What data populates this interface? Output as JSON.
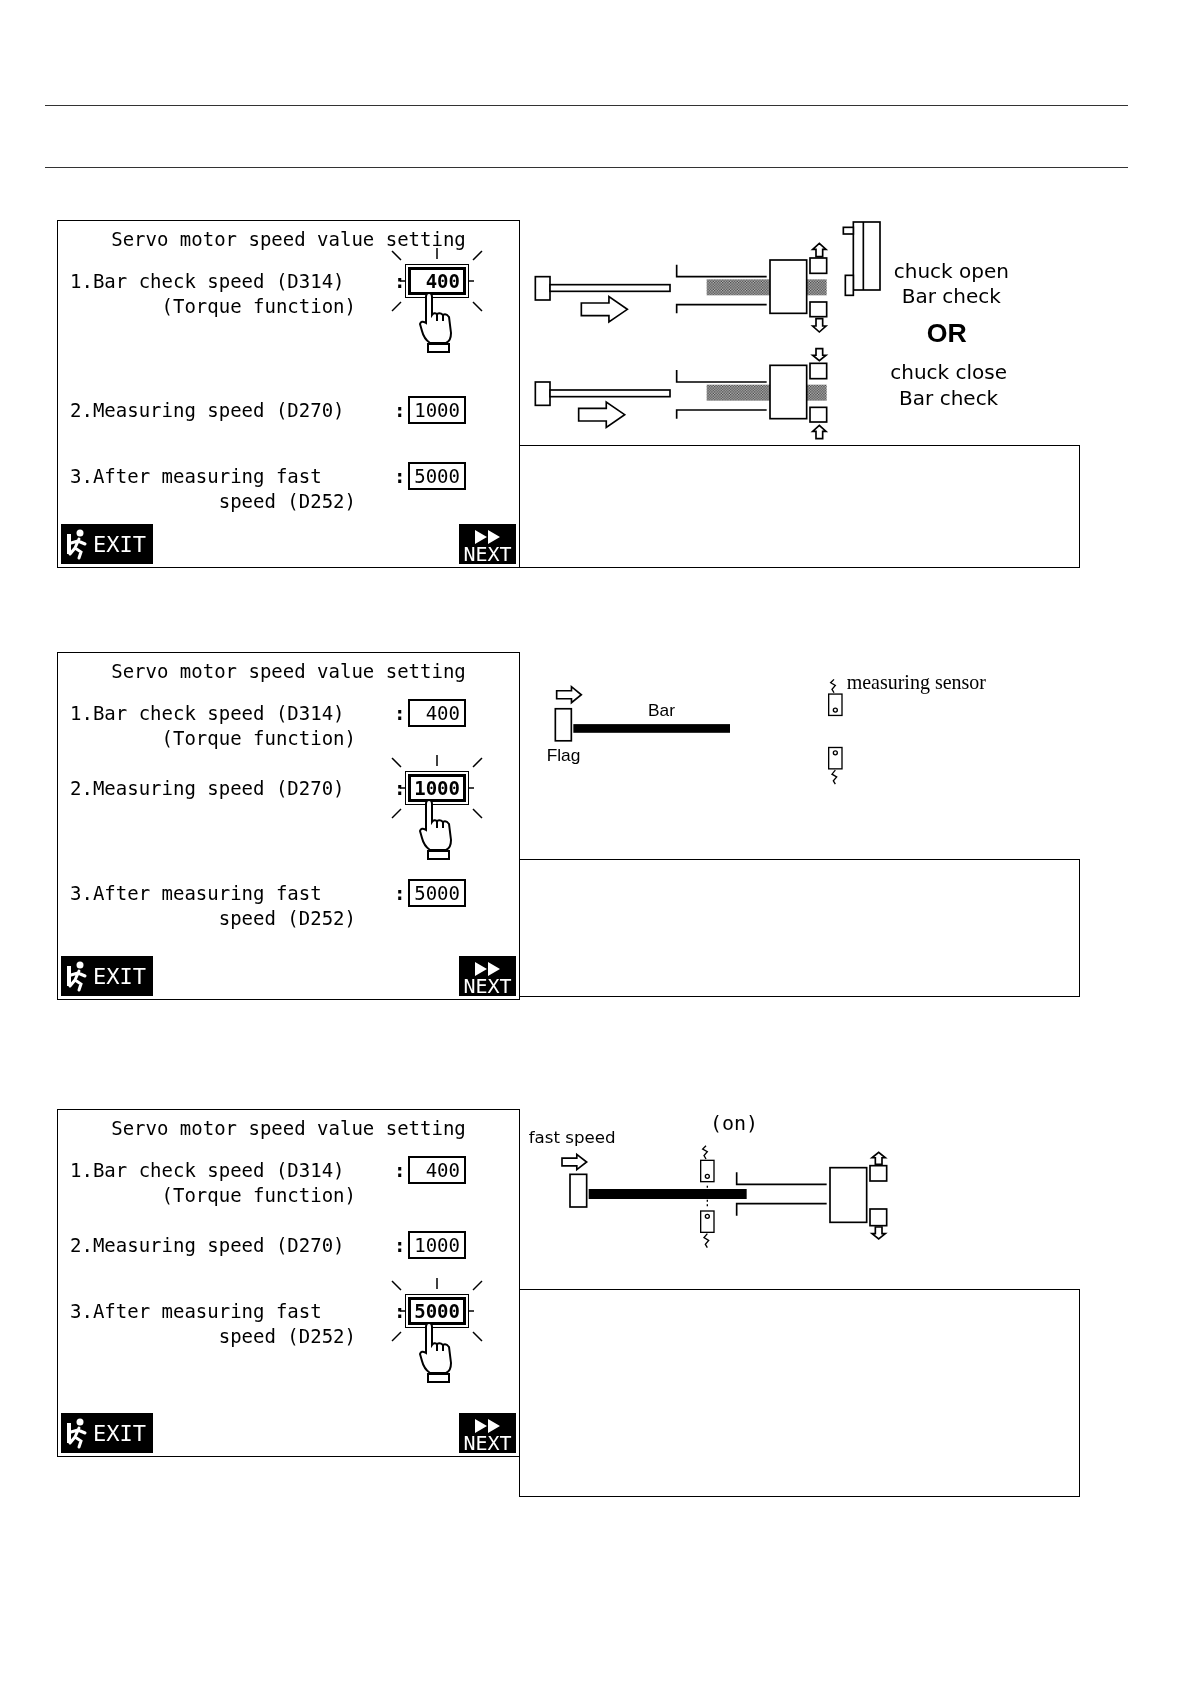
{
  "sections": [
    {
      "screen": {
        "title": "Servo motor speed value setting",
        "settings": [
          {
            "label": "1.Bar check speed (D314)",
            "label_2": "(Torque function)",
            "separator": ":",
            "value": "400",
            "selected": true
          },
          {
            "label": "2.Measuring speed (D270)",
            "separator": ":",
            "value": "1000",
            "selected": false
          },
          {
            "label": "3.After measuring fast",
            "label_2": "speed (D252)",
            "separator": ":",
            "value": "5000",
            "selected": false
          }
        ],
        "exit_button": "EXIT",
        "next_button": "NEXT"
      },
      "diagram": {
        "kind": "chuck_check",
        "labels": [
          "chuck open",
          "Bar check",
          "OR",
          "chuck close",
          "Bar check"
        ]
      }
    },
    {
      "screen": {
        "title": "Servo motor speed value setting",
        "settings": [
          {
            "label": "1.Bar check speed (D314)",
            "label_2": "(Torque function)",
            "separator": ":",
            "value": "400",
            "selected": false
          },
          {
            "label": "2.Measuring speed (D270)",
            "separator": ":",
            "value": "1000",
            "selected": true
          },
          {
            "label": "3.After measuring fast",
            "label_2": "speed (D252)",
            "separator": ":",
            "value": "5000",
            "selected": false
          }
        ],
        "exit_button": "EXIT",
        "next_button": "NEXT"
      },
      "diagram": {
        "kind": "sensor",
        "labels": [
          "Bar",
          "Flag",
          "measuring sensor"
        ]
      }
    },
    {
      "screen": {
        "title": "Servo motor speed value setting",
        "settings": [
          {
            "label": "1.Bar check speed (D314)",
            "label_2": "(Torque function)",
            "separator": ":",
            "value": "400",
            "selected": false
          },
          {
            "label": "2.Measuring speed (D270)",
            "separator": ":",
            "value": "1000",
            "selected": false
          },
          {
            "label": "3.After measuring fast",
            "label_2": "speed (D252)",
            "separator": ":",
            "value": "5000",
            "selected": true
          }
        ],
        "exit_button": "EXIT",
        "next_button": "NEXT"
      },
      "diagram": {
        "kind": "fast_speed",
        "labels": [
          "fast speed",
          "(on)"
        ]
      }
    }
  ]
}
